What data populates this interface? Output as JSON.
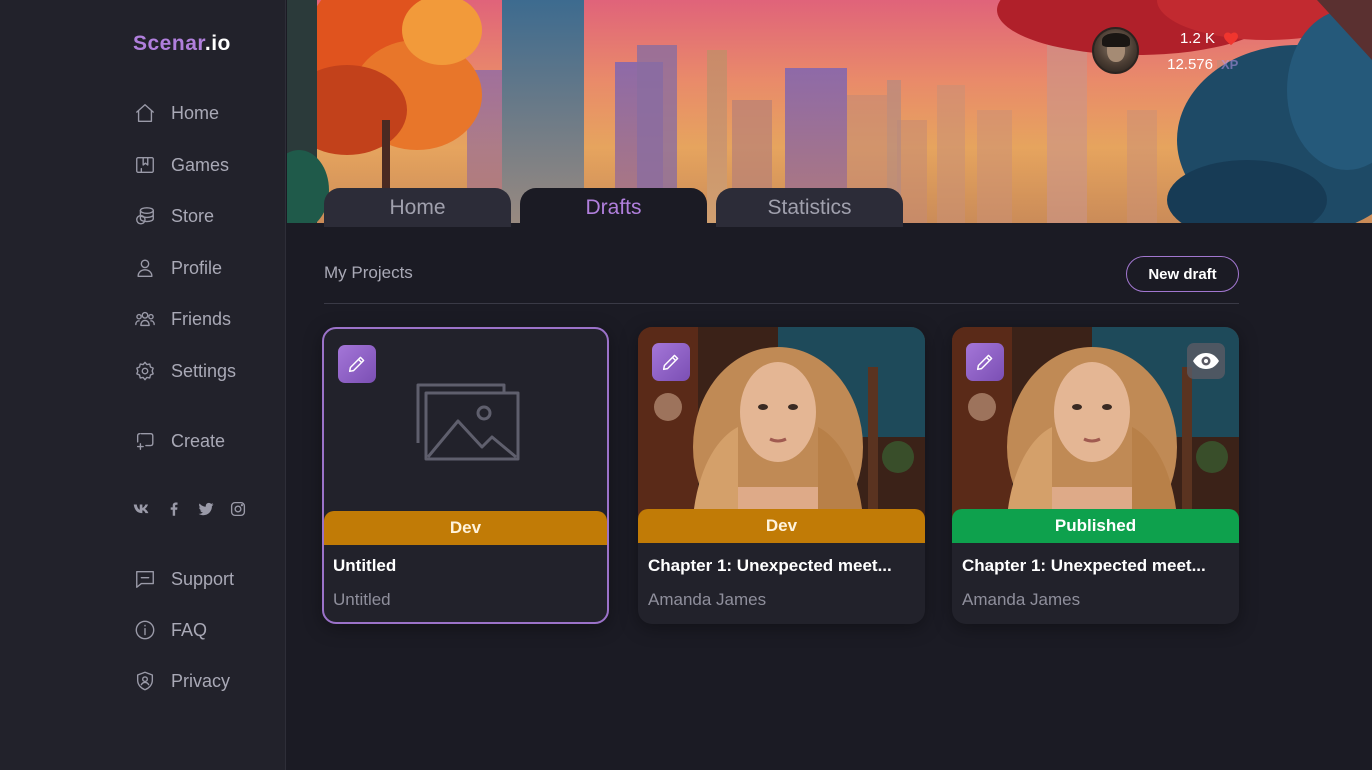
{
  "app": {
    "brand": "Scenar",
    "tld": ".io"
  },
  "sidebar": {
    "items": [
      {
        "label": "Home",
        "icon": "home-icon"
      },
      {
        "label": "Games",
        "icon": "book-icon"
      },
      {
        "label": "Store",
        "icon": "coins-icon"
      },
      {
        "label": "Profile",
        "icon": "user-icon"
      },
      {
        "label": "Friends",
        "icon": "users-icon"
      },
      {
        "label": "Settings",
        "icon": "gear-icon"
      },
      {
        "label": "Create",
        "icon": "create-icon"
      },
      {
        "label": "Support",
        "icon": "chat-icon"
      },
      {
        "label": "FAQ",
        "icon": "info-icon"
      },
      {
        "label": "Privacy",
        "icon": "shield-icon"
      }
    ],
    "social": [
      "vk-icon",
      "facebook-icon",
      "twitter-icon",
      "instagram-icon"
    ]
  },
  "user": {
    "likes": "1.2 K",
    "xp": "12.576",
    "xp_label": "XP"
  },
  "tabs": [
    {
      "label": "Home",
      "active": false
    },
    {
      "label": "Drafts",
      "active": true
    },
    {
      "label": "Statistics",
      "active": false
    }
  ],
  "main": {
    "section_title": "My Projects",
    "new_draft_label": "New draft",
    "cards": [
      {
        "status": "Dev",
        "title": "Untitled",
        "author": "Untitled"
      },
      {
        "status": "Dev",
        "title": "Chapter 1: Unexpected meet...",
        "author": "Amanda James"
      },
      {
        "status": "Published",
        "title": "Chapter 1: Unexpected meet...",
        "author": "Amanda James"
      }
    ]
  },
  "colors": {
    "accent": "#b07fdc",
    "dev": "#c17b06",
    "published": "#0ea14d",
    "background": "#1b1b24",
    "sidebar": "#22222b"
  }
}
